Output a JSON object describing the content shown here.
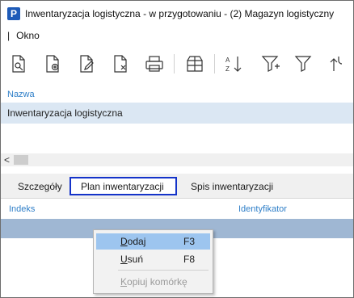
{
  "window": {
    "app_icon_letter": "P",
    "title": "Inwentaryzacja logistyczna - w przygotowaniu - (2) Magazyn logistyczny"
  },
  "menubar": {
    "separator": "|",
    "items": [
      {
        "label": "Okno"
      }
    ]
  },
  "toolbar": {
    "icons": [
      "preview-document-icon",
      "new-document-icon",
      "edit-document-icon",
      "delete-document-icon",
      "print-icon",
      "package-icon",
      "sort-az-icon",
      "filter-add-icon",
      "filter-icon",
      "refresh-arrows-icon"
    ]
  },
  "form": {
    "name_label": "Nazwa",
    "name_value": "Inwentaryzacja logistyczna"
  },
  "scrollbar": {
    "left_arrow": "<"
  },
  "tabs": [
    {
      "label": "Szczegóły",
      "active": false
    },
    {
      "label": "Plan inwentaryzacji",
      "active": true
    },
    {
      "label": "Spis inwentaryzacji",
      "active": false
    }
  ],
  "grid": {
    "columns": [
      "Indeks",
      "Identyfikator"
    ]
  },
  "context_menu": {
    "items": [
      {
        "label_ul": "D",
        "label_rest": "odaj",
        "shortcut": "F3",
        "state": "hover"
      },
      {
        "label_ul": "U",
        "label_rest": "suń",
        "shortcut": "F8",
        "state": "normal"
      },
      {
        "label_ul": "K",
        "label_rest": "opiuj komórkę",
        "shortcut": "",
        "state": "disabled"
      }
    ]
  },
  "colors": {
    "label_blue": "#2f7fc8",
    "selection_row": "#dbe7f3",
    "grid_row": "#9fb7d3",
    "active_tab_border": "#1433c9",
    "menu_hover": "#9dc5ef"
  }
}
